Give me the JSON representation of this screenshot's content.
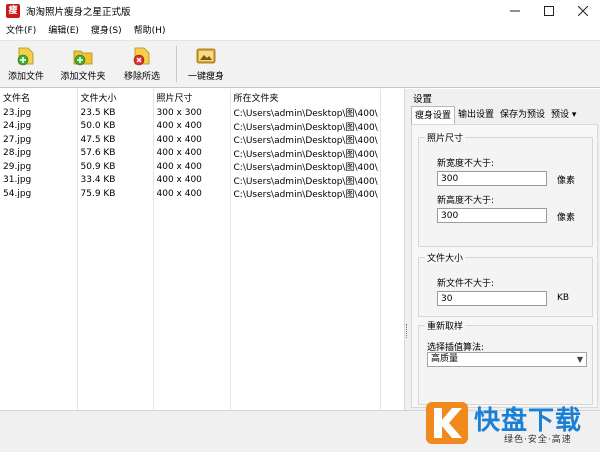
{
  "window": {
    "title": "淘淘照片瘦身之星正式版",
    "icon_text": "瘦"
  },
  "menu": [
    "文件(F)",
    "编辑(E)",
    "瘦身(S)",
    "帮助(H)"
  ],
  "toolbar": {
    "add_file": "添加文件",
    "add_folder": "添加文件夹",
    "remove_selected": "移除所选",
    "one_click": "一键瘦身"
  },
  "table": {
    "columns": [
      "文件名",
      "文件大小",
      "照片尺寸",
      "所在文件夹"
    ],
    "rows": [
      [
        "23.jpg",
        "23.5 KB",
        "300 x 300",
        "C:\\Users\\admin\\Desktop\\图\\400\\"
      ],
      [
        "24.jpg",
        "50.0 KB",
        "400 x 400",
        "C:\\Users\\admin\\Desktop\\图\\400\\"
      ],
      [
        "27.jpg",
        "47.5 KB",
        "400 x 400",
        "C:\\Users\\admin\\Desktop\\图\\400\\"
      ],
      [
        "28.jpg",
        "57.6 KB",
        "400 x 400",
        "C:\\Users\\admin\\Desktop\\图\\400\\"
      ],
      [
        "29.jpg",
        "50.9 KB",
        "400 x 400",
        "C:\\Users\\admin\\Desktop\\图\\400\\"
      ],
      [
        "31.jpg",
        "33.4 KB",
        "400 x 400",
        "C:\\Users\\admin\\Desktop\\图\\400\\"
      ],
      [
        "54.jpg",
        "75.9 KB",
        "400 x 400",
        "C:\\Users\\admin\\Desktop\\图\\400\\"
      ]
    ]
  },
  "settings": {
    "title": "设置",
    "tabs": [
      "瘦身设置",
      "输出设置",
      "保存为预设",
      "预设 ▾"
    ],
    "photo_size": {
      "title": "照片尺寸",
      "width_label": "新宽度不大于:",
      "width_value": "300",
      "height_label": "新高度不大于:",
      "height_value": "300",
      "unit": "像素"
    },
    "file_size": {
      "title": "文件大小",
      "label": "新文件不大于:",
      "value": "30",
      "unit": "KB"
    },
    "resample": {
      "title": "重新取样",
      "label": "选择插值算法:",
      "selected": "高质量"
    }
  },
  "watermark": {
    "name": "快盘下载",
    "tagline": "绿色·安全·高速",
    "logo_glyph": "K"
  },
  "colors": {
    "accent_orange": "#f08a1c",
    "brand_blue": "#1a7fd6",
    "app_icon_red": "#c81818"
  }
}
